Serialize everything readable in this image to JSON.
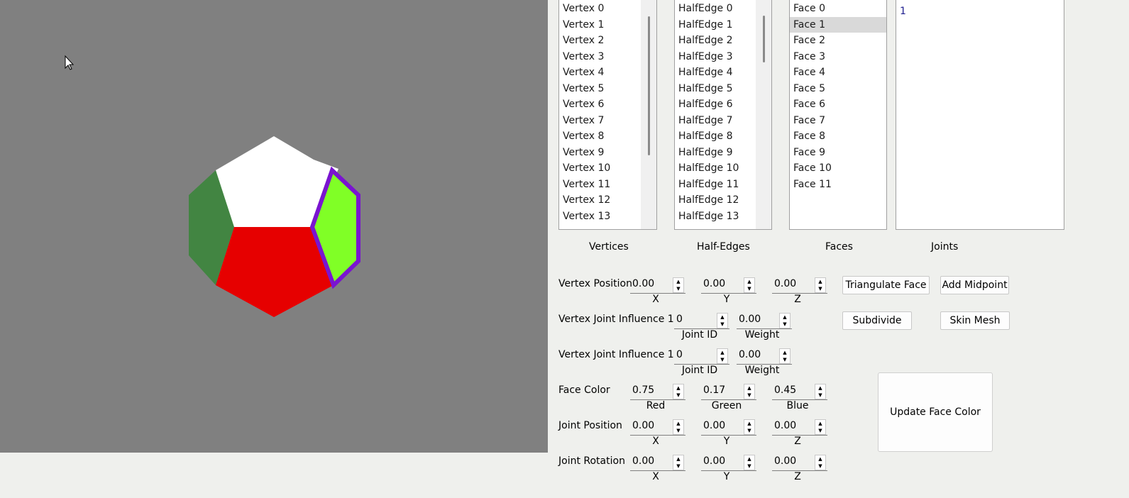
{
  "viewport": {
    "background": "#808080",
    "face_colors": {
      "top": "#ffffff",
      "left": "#428542",
      "bottom": "#e60000",
      "right_selected": "#80ff26",
      "selection_outline": "#7a14d0"
    }
  },
  "lists": {
    "vertices": {
      "label": "Vertices",
      "items": [
        "Vertex 0",
        "Vertex 1",
        "Vertex 2",
        "Vertex 3",
        "Vertex 4",
        "Vertex 5",
        "Vertex 6",
        "Vertex 7",
        "Vertex 8",
        "Vertex 9",
        "Vertex 10",
        "Vertex 11",
        "Vertex 12",
        "Vertex 13"
      ]
    },
    "halfedges": {
      "label": "Half-Edges",
      "items": [
        "HalfEdge 0",
        "HalfEdge 1",
        "HalfEdge 2",
        "HalfEdge 3",
        "HalfEdge 4",
        "HalfEdge 5",
        "HalfEdge 6",
        "HalfEdge 7",
        "HalfEdge 8",
        "HalfEdge 9",
        "HalfEdge 10",
        "HalfEdge 11",
        "HalfEdge 12",
        "HalfEdge 13"
      ]
    },
    "faces": {
      "label": "Faces",
      "items": [
        "Face 0",
        "Face 1",
        "Face 2",
        "Face 3",
        "Face 4",
        "Face 5",
        "Face 6",
        "Face 7",
        "Face 8",
        "Face 9",
        "Face 10",
        "Face 11"
      ],
      "selected": "Face 1"
    },
    "joints": {
      "label": "Joints",
      "items": [
        "1"
      ]
    }
  },
  "controls": {
    "vertex_position": {
      "label": "Vertex Position",
      "x": "0.00",
      "y": "0.00",
      "z": "0.00",
      "x_label": "X",
      "y_label": "Y",
      "z_label": "Z"
    },
    "influence1": {
      "label": "Vertex Joint Influence 1",
      "joint_id": "0",
      "weight": "0.00",
      "joint_label": "Joint ID",
      "weight_label": "Weight"
    },
    "influence2": {
      "label": "Vertex Joint Influence 1",
      "joint_id": "0",
      "weight": "0.00",
      "joint_label": "Joint ID",
      "weight_label": "Weight"
    },
    "face_color": {
      "label": "Face Color",
      "red": "0.75",
      "green": "0.17",
      "blue": "0.45",
      "red_label": "Red",
      "green_label": "Green",
      "blue_label": "Blue"
    },
    "joint_position": {
      "label": "Joint Position",
      "x": "0.00",
      "y": "0.00",
      "z": "0.00",
      "x_label": "X",
      "y_label": "Y",
      "z_label": "Z"
    },
    "joint_rotation": {
      "label": "Joint Rotation",
      "x": "0.00",
      "y": "0.00",
      "z": "0.00",
      "x_label": "X",
      "y_label": "Y",
      "z_label": "Z"
    }
  },
  "buttons": {
    "triangulate": "Triangulate Face",
    "midpoint": "Add Midpoint",
    "subdivide": "Subdivide",
    "skin": "Skin Mesh",
    "update_color": "Update Face Color"
  }
}
